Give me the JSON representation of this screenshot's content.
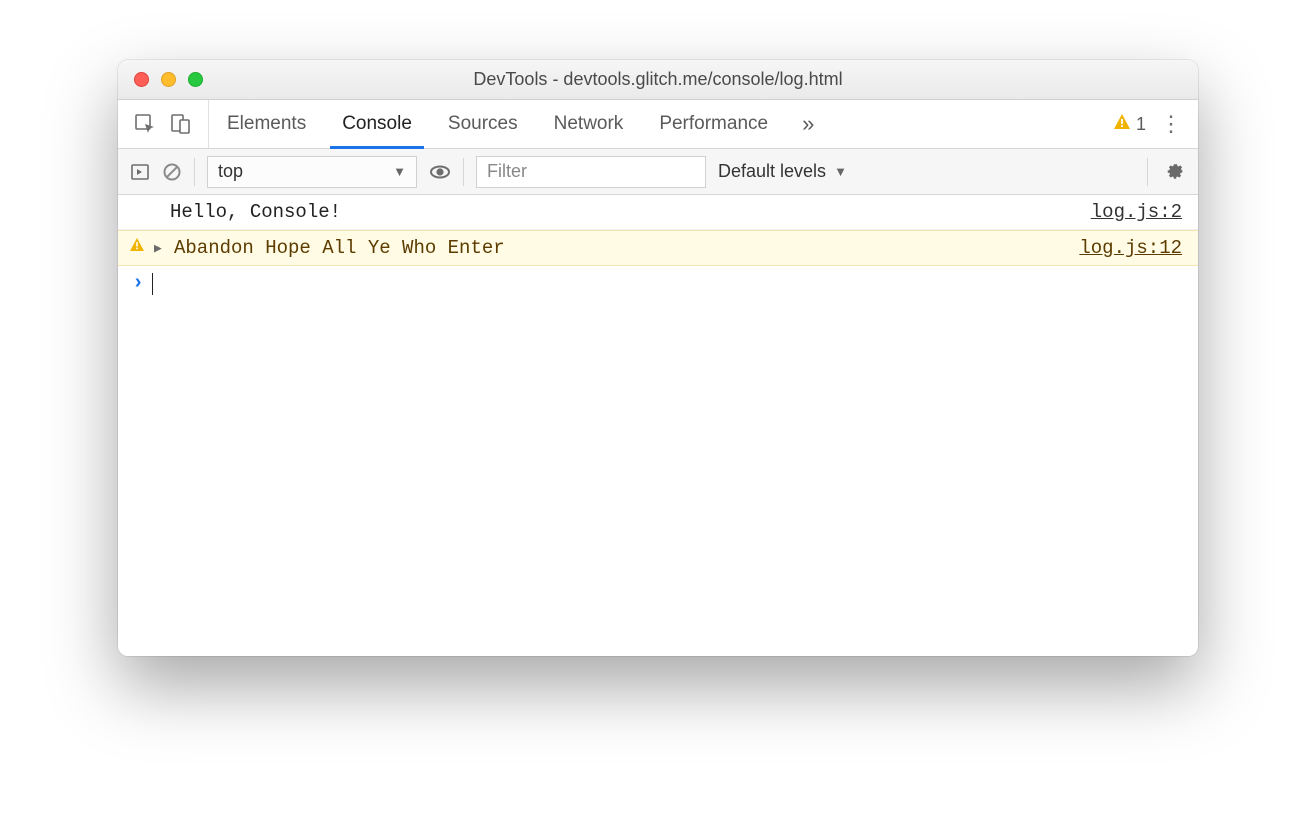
{
  "window": {
    "title": "DevTools - devtools.glitch.me/console/log.html"
  },
  "tabs": {
    "items": [
      "Elements",
      "Console",
      "Sources",
      "Network",
      "Performance"
    ],
    "active": "Console",
    "more_glyph": "»",
    "warning_count": "1"
  },
  "filterbar": {
    "context": "top",
    "filter_placeholder": "Filter",
    "levels_label": "Default levels"
  },
  "console": {
    "rows": [
      {
        "type": "info",
        "message": "Hello, Console!",
        "source": "log.js:2"
      },
      {
        "type": "warn",
        "message": "Abandon Hope All Ye Who Enter",
        "source": "log.js:12"
      }
    ]
  }
}
